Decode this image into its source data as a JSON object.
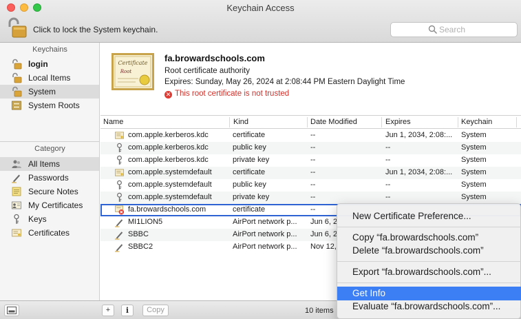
{
  "window": {
    "title": "Keychain Access"
  },
  "toolbar": {
    "lock_text": "Click to lock the System keychain.",
    "search_placeholder": "Search"
  },
  "sidebar": {
    "keychains_header": "Keychains",
    "keychains": [
      {
        "label": "login",
        "icon": "lock-open-icon",
        "bold": true
      },
      {
        "label": "Local Items",
        "icon": "lock-open-icon"
      },
      {
        "label": "System",
        "icon": "lock-open-icon",
        "selected": true
      },
      {
        "label": "System Roots",
        "icon": "cabinet-icon"
      }
    ],
    "category_header": "Category",
    "categories": [
      {
        "label": "All Items",
        "icon": "people-icon",
        "selected": true
      },
      {
        "label": "Passwords",
        "icon": "pencil-icon"
      },
      {
        "label": "Secure Notes",
        "icon": "note-icon"
      },
      {
        "label": "My Certificates",
        "icon": "mycert-icon"
      },
      {
        "label": "Keys",
        "icon": "key-icon"
      },
      {
        "label": "Certificates",
        "icon": "certificate-icon"
      }
    ]
  },
  "detail": {
    "name": "fa.browardschools.com",
    "kind": "Root certificate authority",
    "expires": "Expires: Sunday, May 26, 2024 at 2:08:44 PM Eastern Daylight Time",
    "warning": "This root certificate is not trusted"
  },
  "table": {
    "columns": [
      "Name",
      "Kind",
      "Date Modified",
      "Expires",
      "Keychain"
    ],
    "rows": [
      {
        "name": "com.apple.kerberos.kdc",
        "kind": "certificate",
        "modified": "--",
        "expires": "Jun 1, 2034, 2:08:...",
        "keychain": "System",
        "icon": "cert"
      },
      {
        "name": "com.apple.kerberos.kdc",
        "kind": "public key",
        "modified": "--",
        "expires": "--",
        "keychain": "System",
        "icon": "key"
      },
      {
        "name": "com.apple.kerberos.kdc",
        "kind": "private key",
        "modified": "--",
        "expires": "--",
        "keychain": "System",
        "icon": "key"
      },
      {
        "name": "com.apple.systemdefault",
        "kind": "certificate",
        "modified": "--",
        "expires": "Jun 1, 2034, 2:08:...",
        "keychain": "System",
        "icon": "cert"
      },
      {
        "name": "com.apple.systemdefault",
        "kind": "public key",
        "modified": "--",
        "expires": "--",
        "keychain": "System",
        "icon": "key"
      },
      {
        "name": "com.apple.systemdefault",
        "kind": "private key",
        "modified": "--",
        "expires": "--",
        "keychain": "System",
        "icon": "key"
      },
      {
        "name": "fa.browardschools.com",
        "kind": "certificate",
        "modified": "--",
        "expires": "",
        "keychain": "",
        "icon": "certx",
        "selected": true
      },
      {
        "name": "MI1LION5",
        "kind": "AirPort network p...",
        "modified": "Jun 6, 2",
        "expires": "",
        "keychain": "",
        "icon": "pencil"
      },
      {
        "name": "SBBC",
        "kind": "AirPort network p...",
        "modified": "Jun 6, 2",
        "expires": "",
        "keychain": "",
        "icon": "pencil"
      },
      {
        "name": "SBBC2",
        "kind": "AirPort network p...",
        "modified": "Nov 12,",
        "expires": "",
        "keychain": "",
        "icon": "pencil"
      }
    ]
  },
  "bottombar": {
    "add_label": "+",
    "info_label": "i",
    "copy_label": "Copy",
    "count": "10 items"
  },
  "context_menu": {
    "items": [
      "New Certificate Preference...",
      "Copy “fa.browardschools.com”",
      "Delete “fa.browardschools.com”",
      "Export “fa.browardschools.com”...",
      "Get Info",
      "Evaluate “fa.browardschools.com”..."
    ]
  },
  "colors": {
    "selection_blue": "#3c7ff5",
    "warning_red": "#d0302a"
  }
}
